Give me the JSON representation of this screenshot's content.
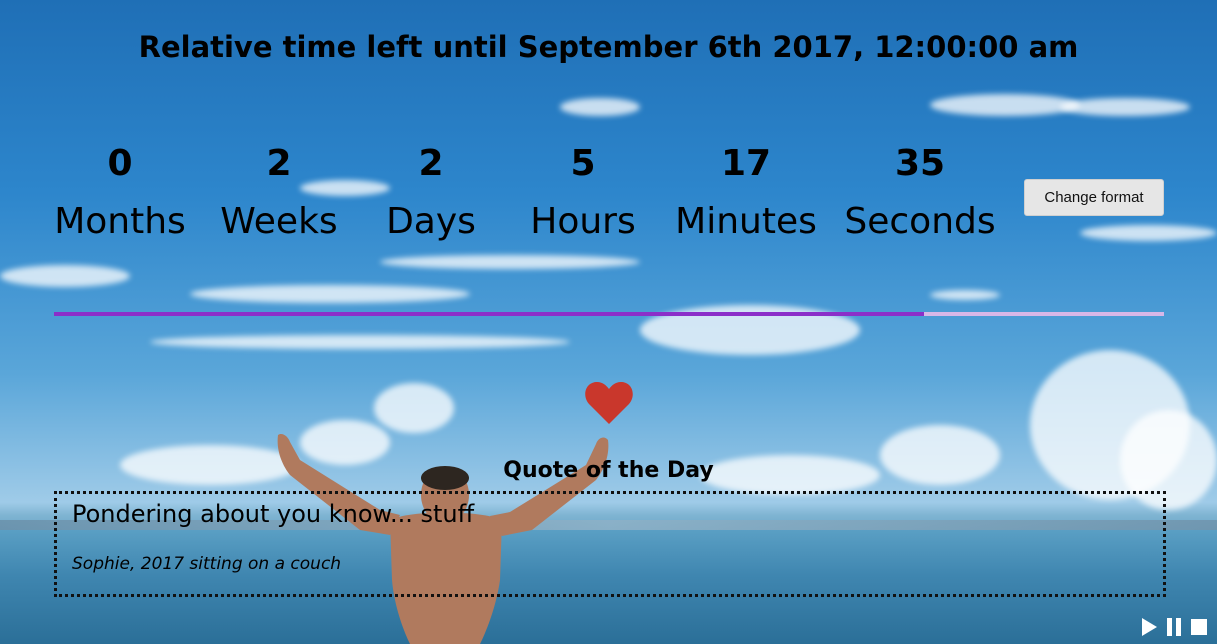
{
  "title": "Relative time left until September 6th 2017, 12:00:00 am",
  "countdown": {
    "months": {
      "value": "0",
      "label": "Months"
    },
    "weeks": {
      "value": "2",
      "label": "Weeks"
    },
    "days": {
      "value": "2",
      "label": "Days"
    },
    "hours": {
      "value": "5",
      "label": "Hours"
    },
    "minutes": {
      "value": "17",
      "label": "Minutes"
    },
    "seconds": {
      "value": "35",
      "label": "Seconds"
    }
  },
  "change_format_label": "Change format",
  "progress": {
    "fraction": 0.784,
    "fill_color": "#8b2fc9",
    "track_color": "#d7b7e8"
  },
  "heart_icon": {
    "color": "#c9372c"
  },
  "quote": {
    "heading": "Quote of the Day",
    "text": "Pondering about you know... stuff",
    "author": "Sophie, 2017 sitting on a couch"
  },
  "media_controls": {
    "icons": [
      "play-icon",
      "pause-icon",
      "stop-icon"
    ]
  }
}
